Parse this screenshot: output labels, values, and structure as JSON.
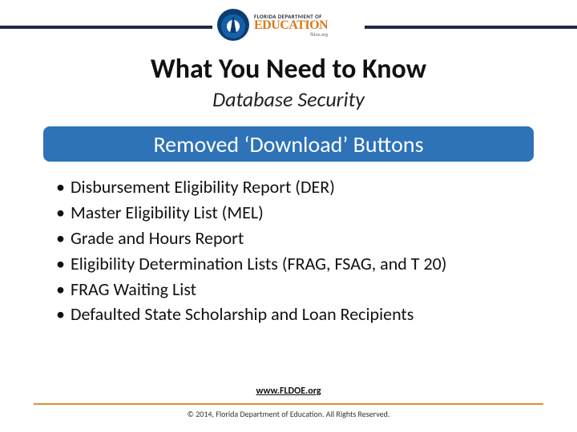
{
  "logo": {
    "line1": "FLORIDA DEPARTMENT OF",
    "line2": "EDUCATION",
    "small_url": "fldoe.org"
  },
  "header": {
    "title": "What You Need to Know",
    "subtitle": "Database Security"
  },
  "banner": {
    "text": "Removed ‘Download’ Buttons"
  },
  "bullets": [
    "Disbursement Eligibility Report (DER)",
    "Master Eligibility List (MEL)",
    "Grade and Hours Report",
    "Eligibility Determination Lists (FRAG, FSAG, and T 20)",
    "FRAG Waiting List",
    "Defaulted State Scholarship and Loan Recipients"
  ],
  "footer": {
    "link_text": "www.FLDOE.org",
    "copyright": "© 2014, Florida Department of Education. All Rights Reserved."
  }
}
